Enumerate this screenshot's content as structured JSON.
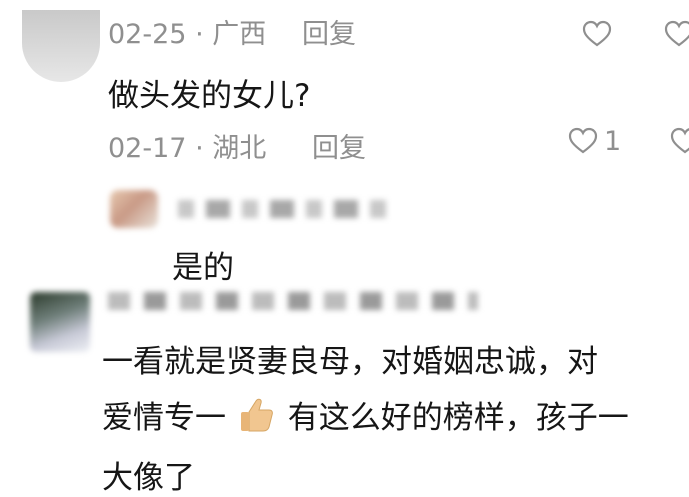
{
  "comments": [
    {
      "date": "02-25",
      "sep": "·",
      "location": "广西",
      "reply_label": "回复",
      "like_count": ""
    },
    {
      "text": "做头发的女儿?",
      "date": "02-17",
      "sep": "·",
      "location": "湖北",
      "reply_label": "回复",
      "like_count": "1"
    },
    {
      "text": "是的"
    },
    {
      "line1": "一看就是贤妻良母，对婚姻忠诚，对",
      "line2_before": "爱情专一",
      "line2_after": "有这么好的榜样，孩子一",
      "line3": "大像了"
    }
  ],
  "icons": {
    "like": "heart-outline-icon",
    "emoji": "thumbs-up-emoji"
  },
  "colors": {
    "meta_text": "#8f8f8f",
    "body_text": "#161616",
    "emoji_skin": "#f1c690"
  }
}
